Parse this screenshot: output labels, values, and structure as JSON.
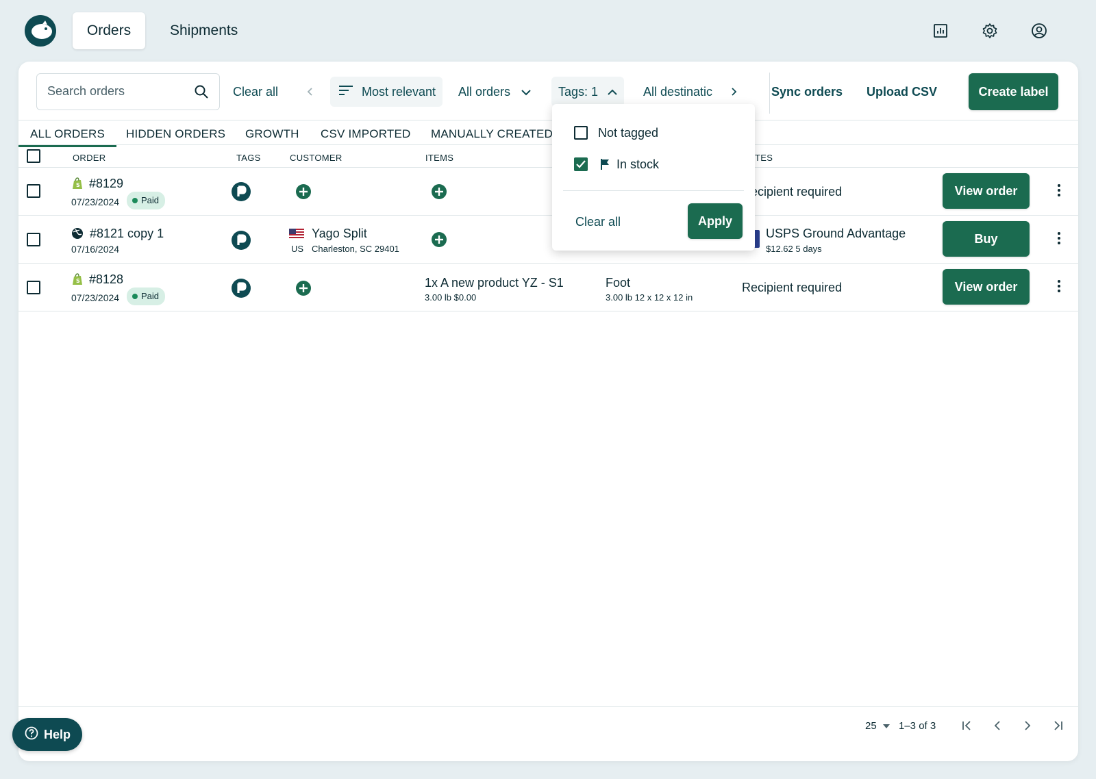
{
  "nav": {
    "tabs": [
      {
        "label": "Orders",
        "active": true
      },
      {
        "label": "Shipments",
        "active": false
      }
    ],
    "icons": [
      "reports-icon",
      "settings-icon",
      "account-icon"
    ]
  },
  "toolbar": {
    "search_placeholder": "Search orders",
    "clear_all": "Clear all",
    "sort_label": "Most relevant",
    "filter_orders": "All orders",
    "filter_tags": "Tags: 1",
    "filter_destinations": "All destinatic",
    "sync": "Sync orders",
    "upload": "Upload CSV",
    "create": "Create label"
  },
  "view_tabs": [
    "ALL ORDERS",
    "HIDDEN ORDERS",
    "GROWTH",
    "CSV IMPORTED",
    "MANUALLY CREATED"
  ],
  "columns": {
    "order": "ORDER",
    "tags": "TAGS",
    "customer": "CUSTOMER",
    "items": "ITEMS",
    "rates": "TES"
  },
  "rows": [
    {
      "source_icon": "shopify-icon",
      "order": "#8129",
      "date": "07/23/2024",
      "status": "Paid",
      "customer_name": "",
      "customer_country": "",
      "customer_address": "",
      "item": "",
      "item_sub": "",
      "package": "",
      "package_sub": "",
      "rate": "ecipient required",
      "rate_sub": "",
      "action": "View order"
    },
    {
      "source_icon": "globe-icon",
      "order": "#8121 copy 1",
      "date": "07/16/2024",
      "status": "",
      "customer_name": "Yago Split",
      "customer_country": "US",
      "customer_address": "Charleston, SC 29401",
      "item": "",
      "item_sub": "",
      "package": "",
      "package_sub": "",
      "rate": "USPS Ground Advantage",
      "rate_sub": "$12.62  5 days",
      "action": "Buy"
    },
    {
      "source_icon": "shopify-icon",
      "order": "#8128",
      "date": "07/23/2024",
      "status": "Paid",
      "customer_name": "",
      "customer_country": "",
      "customer_address": "",
      "item": "1x A new product YZ - S1",
      "item_sub": "3.00 lb   $0.00",
      "package": "Foot",
      "package_sub": "3.00 lb  12 x 12 x 12 in",
      "rate": "Recipient required",
      "rate_sub": "",
      "action": "View order"
    }
  ],
  "tags_dropdown": {
    "options": [
      {
        "label": "Not tagged",
        "checked": false
      },
      {
        "label": "In stock",
        "checked": true,
        "icon": "flag-icon"
      }
    ],
    "clear_all": "Clear all",
    "apply": "Apply"
  },
  "pagination": {
    "page_size": "25",
    "range": "1–3 of 3"
  },
  "help": "Help",
  "colors": {
    "primary": "#1b6b50",
    "dark": "#0e4a52",
    "paid_bg": "#d7efe5",
    "background": "#e6eef1"
  }
}
